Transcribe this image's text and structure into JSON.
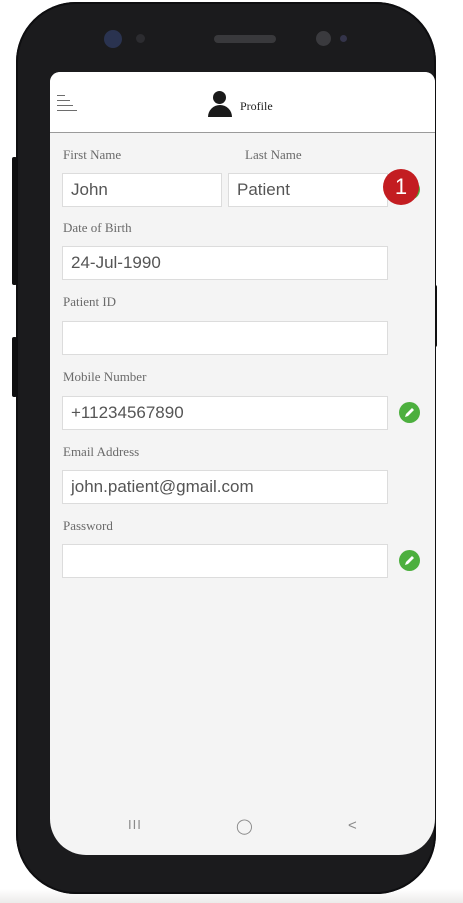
{
  "header": {
    "title": "Profile"
  },
  "form": {
    "first_name_label": "First Name",
    "last_name_label": "Last Name",
    "first_name_value": "John",
    "last_name_value": "Patient",
    "dob_label": "Date of Birth",
    "dob_value": "24-Jul-1990",
    "patient_id_label": "Patient ID",
    "patient_id_value": "",
    "mobile_label": "Mobile Number",
    "mobile_value": "+11234567890",
    "email_label": "Email Address",
    "email_value": "john.patient@gmail.com",
    "password_label": "Password",
    "password_value": ""
  },
  "annotation": {
    "badge": "1"
  },
  "nav": {
    "recent": "III",
    "home": "◯",
    "back": "<"
  },
  "colors": {
    "edit_green": "#4caf3e",
    "badge_red": "#c31d21"
  }
}
